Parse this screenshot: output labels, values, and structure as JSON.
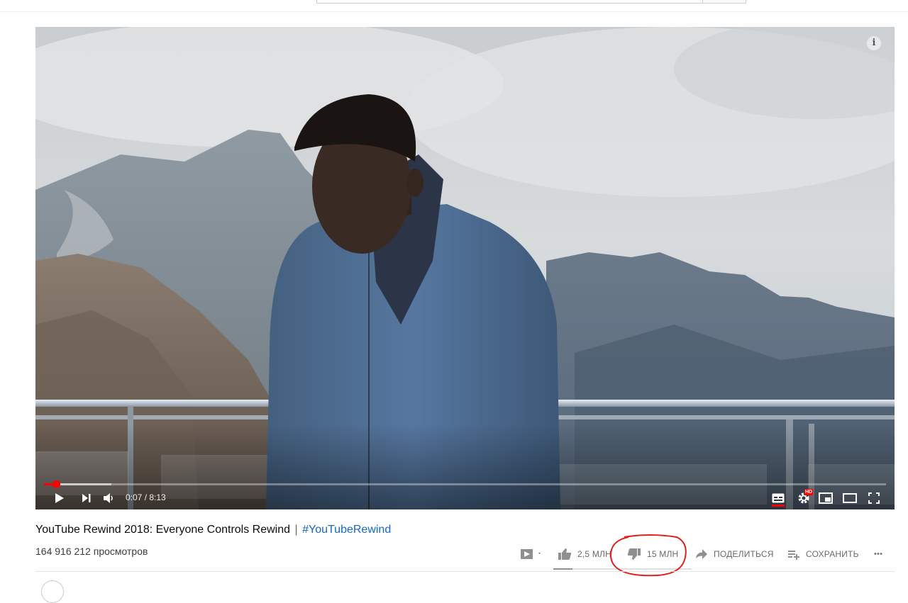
{
  "video": {
    "title": "YouTube Rewind 2018: Everyone Controls Rewind",
    "title_separator": "|",
    "hashtag": "#YouTubeRewind",
    "views": "164 916 212 просмотров",
    "current_time": "0:07",
    "duration": "8:13",
    "time_display": "0:07 / 8:13",
    "progress_fraction": 0.014
  },
  "actions": {
    "like_count": "2,5 МЛН",
    "dislike_count": "15 МЛН",
    "share_label": "ПОДЕЛИТЬСЯ",
    "save_label": "СОХРАНИТЬ",
    "more_label": "•••",
    "like_ratio": 0.14
  },
  "player_buttons": {
    "info_label": "i",
    "hd_badge": "HD"
  },
  "colors": {
    "progress_played": "#ff0000",
    "hashtag_link": "#1667c6",
    "annotation_circle": "#e0201c",
    "action_text": "#6a6a6a"
  },
  "icons": [
    "play-icon",
    "next-icon",
    "volume-icon",
    "subtitles-icon",
    "settings-icon",
    "miniplayer-icon",
    "theater-icon",
    "fullscreen-icon",
    "info-icon",
    "addto-icon",
    "thumbs-up-icon",
    "thumbs-down-icon",
    "share-icon",
    "playlist-add-icon",
    "more-icon"
  ]
}
